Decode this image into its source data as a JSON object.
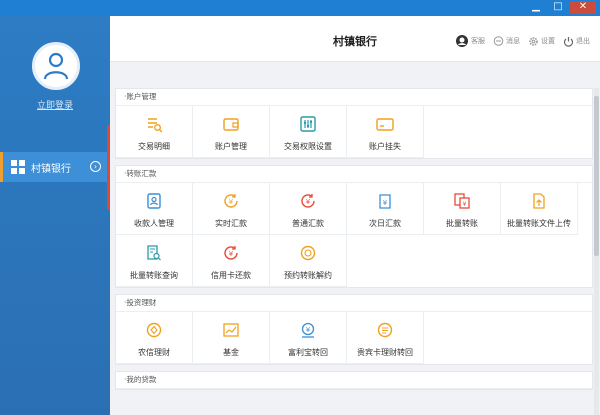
{
  "window": {
    "minimize": "▁",
    "maximize": "□",
    "close": "✕"
  },
  "sidebar": {
    "login_label": "立即登录",
    "nav_items": [
      {
        "label": "村镇银行",
        "arrow": "›"
      }
    ]
  },
  "header": {
    "title": "村镇银行",
    "actions": [
      {
        "label": "客服",
        "icon": "headset-icon"
      },
      {
        "label": "消息",
        "icon": "chat-icon"
      },
      {
        "label": "设置",
        "icon": "gear-icon"
      },
      {
        "label": "退出",
        "icon": "power-icon"
      }
    ]
  },
  "sections": [
    {
      "title": "·账户管理",
      "tiles": [
        {
          "label": "交易明细",
          "icon": "list-search-icon",
          "color": "#f0a020"
        },
        {
          "label": "账户管理",
          "icon": "wallet-icon",
          "color": "#f0a020"
        },
        {
          "label": "交易权限设置",
          "icon": "sliders-icon",
          "color": "#2a9aa8"
        },
        {
          "label": "账户挂失",
          "icon": "card-lock-icon",
          "color": "#f0a020"
        }
      ]
    },
    {
      "title": "·转账汇款",
      "tiles": [
        {
          "label": "收款人管理",
          "icon": "contact-icon",
          "color": "#3a8fd8"
        },
        {
          "label": "实时汇款",
          "icon": "yuan-refresh-icon",
          "color": "#f0a020"
        },
        {
          "label": "普通汇款",
          "icon": "yuan-coin-icon",
          "color": "#e84a3a"
        },
        {
          "label": "次日汇款",
          "icon": "yuan-calendar-icon",
          "color": "#3a8fd8"
        },
        {
          "label": "批量转账",
          "icon": "batch-transfer-icon",
          "color": "#e84a3a"
        },
        {
          "label": "批量转账文件上传",
          "icon": "file-upload-icon",
          "color": "#f0a020"
        },
        {
          "label": "批量转账查询",
          "icon": "doc-search-icon",
          "color": "#2a9aa8"
        },
        {
          "label": "信用卡还款",
          "icon": "credit-refresh-icon",
          "color": "#e84a3a"
        },
        {
          "label": "预约转账解约",
          "icon": "schedule-coin-icon",
          "color": "#f0a020"
        }
      ]
    },
    {
      "title": "·投资理财",
      "tiles": [
        {
          "label": "农信理财",
          "icon": "diamond-coin-icon",
          "color": "#f0a020"
        },
        {
          "label": "基金",
          "icon": "chart-icon",
          "color": "#f0a020"
        },
        {
          "label": "富利宝转回",
          "icon": "yuan-return-icon",
          "color": "#3a8fd8"
        },
        {
          "label": "贵宾卡理财转回",
          "icon": "vip-list-icon",
          "color": "#f0a020"
        }
      ]
    },
    {
      "title": "·我的贷款",
      "tiles": []
    }
  ]
}
